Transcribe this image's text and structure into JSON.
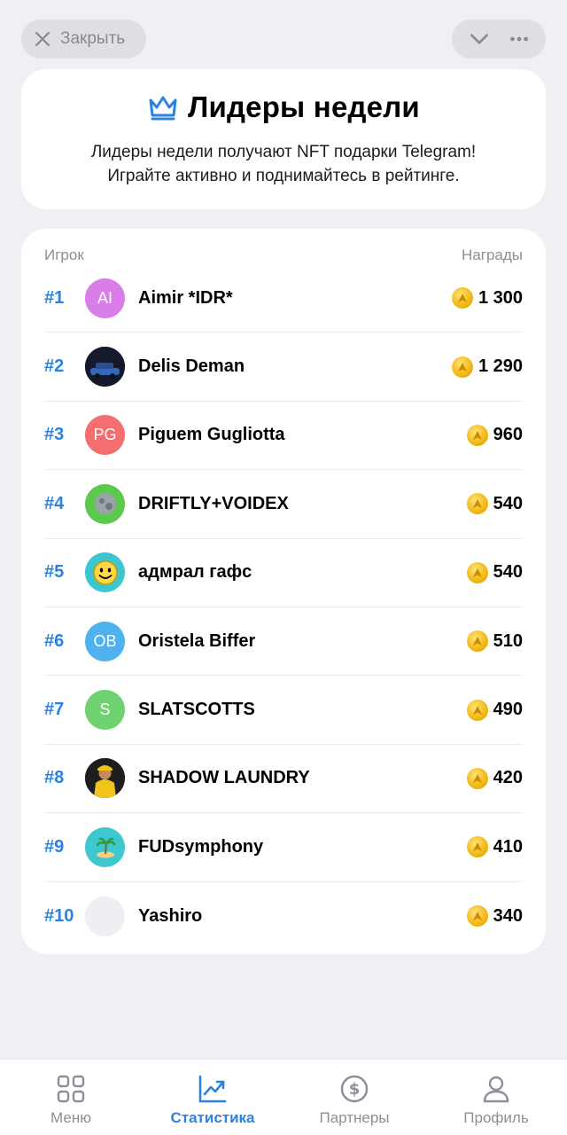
{
  "topbar": {
    "close_label": "Закрыть"
  },
  "header": {
    "title": "Лидеры недели",
    "subtitle_line1": "Лидеры недели получают NFT подарки Telegram!",
    "subtitle_line2": "Играйте активно и поднимайтесь в рейтинге."
  },
  "table": {
    "col_player": "Игрок",
    "col_rewards": "Награды",
    "rows": [
      {
        "rank": "#1",
        "name": "Aimir *IDR*",
        "initials": "AI",
        "avatar_color": "#d97de8",
        "reward": "1 300"
      },
      {
        "rank": "#2",
        "name": "Delis Deman",
        "initials": "",
        "avatar_color": "#1b2236",
        "reward": "1 290"
      },
      {
        "rank": "#3",
        "name": "Piguem Gugliotta",
        "initials": "PG",
        "avatar_color": "#f36e6e",
        "reward": "960"
      },
      {
        "rank": "#4",
        "name": "DRIFTLY+VOIDEX",
        "initials": "",
        "avatar_color": "#5cc84d",
        "reward": "540"
      },
      {
        "rank": "#5",
        "name": "адмрал гафс",
        "initials": "",
        "avatar_color": "#3cc6cf",
        "reward": "540"
      },
      {
        "rank": "#6",
        "name": "Oristela Biffer",
        "initials": "OB",
        "avatar_color": "#4fb2ee",
        "reward": "510"
      },
      {
        "rank": "#7",
        "name": "SLATSCOTTS",
        "initials": "S",
        "avatar_color": "#6fd16f",
        "reward": "490"
      },
      {
        "rank": "#8",
        "name": "SHADOW LAUNDRY",
        "initials": "",
        "avatar_color": "#2a2a2a",
        "reward": "420"
      },
      {
        "rank": "#9",
        "name": "FUDsymphony",
        "initials": "",
        "avatar_color": "#3ec7cf",
        "reward": "410"
      },
      {
        "rank": "#10",
        "name": "Yashiro",
        "initials": "",
        "avatar_color": "#eeeff3",
        "reward": "340"
      }
    ]
  },
  "tabs": [
    {
      "label": "Меню",
      "icon": "grid-icon",
      "active": false
    },
    {
      "label": "Статистика",
      "icon": "chart-icon",
      "active": true
    },
    {
      "label": "Партнеры",
      "icon": "dollar-icon",
      "active": false
    },
    {
      "label": "Профиль",
      "icon": "user-icon",
      "active": false
    }
  ],
  "colors": {
    "accent": "#2b82e3",
    "coin": "#f1b712",
    "background": "#efeff4"
  }
}
